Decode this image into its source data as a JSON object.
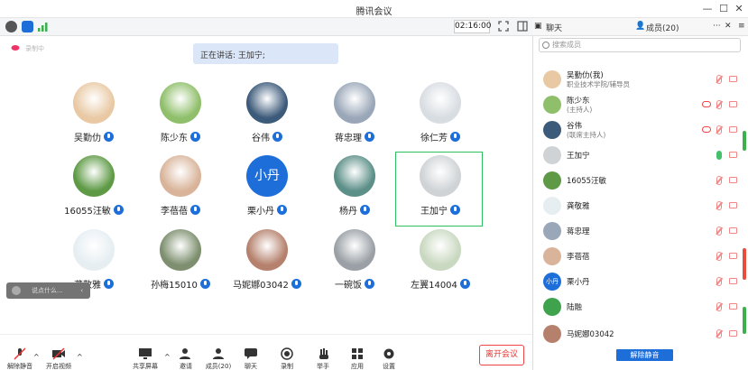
{
  "window": {
    "title": "腾讯会议",
    "minimize": "—",
    "maximize": "☐",
    "close": "✕"
  },
  "status": {
    "timer": "02:16:00",
    "recording": "录制中"
  },
  "speaking": {
    "label": "正在讲话: 王加宁;"
  },
  "tiles": [
    {
      "name": "吴勤仂",
      "color": "#e9c9a4"
    },
    {
      "name": "陈少东",
      "color": "#8fbf6a"
    },
    {
      "name": "谷伟",
      "color": "#3c5a7a"
    },
    {
      "name": "蒋忠理",
      "color": "#9aa7b8"
    },
    {
      "name": "徐仁芳",
      "color": "#d8dde2"
    },
    {
      "name": "16055汪敏",
      "color": "#5e9a45"
    },
    {
      "name": "李蓓蓓",
      "color": "#d9b49a"
    },
    {
      "name": "栗小丹",
      "color": "#1e6ed9",
      "initials": "小丹"
    },
    {
      "name": "杨丹",
      "color": "#5c8f88"
    },
    {
      "name": "王加宁",
      "color": "#cfd3d6"
    },
    {
      "name": "龚敬雅",
      "color": "#e6eef2"
    },
    {
      "name": "孙梅15010",
      "color": "#7d8f6e"
    },
    {
      "name": "马妮娜03042",
      "color": "#b5816d"
    },
    {
      "name": "一碗饭",
      "color": "#9aa0a6"
    },
    {
      "name": "左翼14004",
      "color": "#c9d8c0"
    }
  ],
  "chat_input": {
    "placeholder": "说点什么..."
  },
  "toolbar": {
    "unmute": "解除静音",
    "video": "开启视频",
    "share": "共享屏幕",
    "invite": "邀请",
    "members": "成员(20)",
    "chat": "聊天",
    "record": "录制",
    "raise": "举手",
    "apps": "应用",
    "settings": "设置",
    "leave": "离开会议"
  },
  "side": {
    "tab_chat": "聊天",
    "tab_members": "成员(20)",
    "search_placeholder": "搜索成员",
    "unmute_all": "解除静音",
    "members": [
      {
        "name": "吴勤仂(我)",
        "sub": "职业技术学院/辅导员",
        "color": "#e9c9a4"
      },
      {
        "name": "陈少东",
        "sub": "(主持人)",
        "color": "#8fbf6a"
      },
      {
        "name": "谷伟",
        "sub": "(联席主持人)",
        "color": "#3c5a7a"
      },
      {
        "name": "王加宁",
        "sub": "",
        "color": "#cfd3d6"
      },
      {
        "name": "16055汪敏",
        "sub": "",
        "color": "#5e9a45"
      },
      {
        "name": "龚敬雅",
        "sub": "",
        "color": "#e6eef2"
      },
      {
        "name": "蒋忠理",
        "sub": "",
        "color": "#9aa7b8"
      },
      {
        "name": "李蓓蓓",
        "sub": "",
        "color": "#d9b49a"
      },
      {
        "name": "栗小丹",
        "sub": "",
        "color": "#1e6ed9",
        "initials": "小丹"
      },
      {
        "name": "陆融",
        "sub": "",
        "color": "#3fa34d"
      },
      {
        "name": "马妮娜03042",
        "sub": "",
        "color": "#b5816d"
      }
    ]
  }
}
